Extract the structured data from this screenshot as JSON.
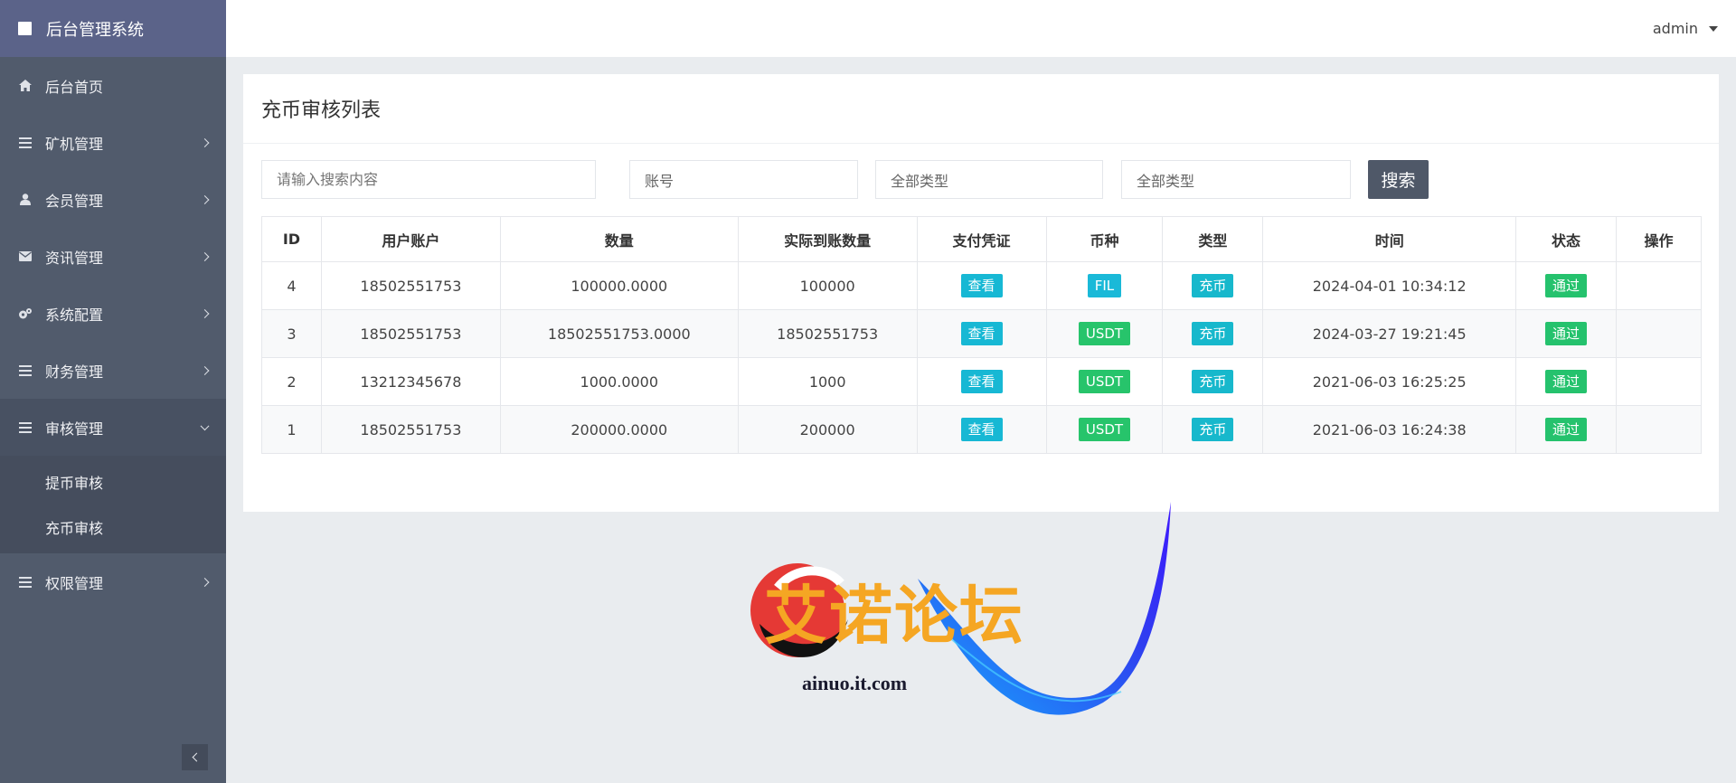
{
  "brand": {
    "title": "后台管理系统"
  },
  "header": {
    "user": "admin"
  },
  "sidebar": {
    "items": [
      {
        "label": "后台首页",
        "icon": "home-icon"
      },
      {
        "label": "矿机管理",
        "icon": "list-icon"
      },
      {
        "label": "会员管理",
        "icon": "user-icon"
      },
      {
        "label": "资讯管理",
        "icon": "mail-icon"
      },
      {
        "label": "系统配置",
        "icon": "gears-icon"
      },
      {
        "label": "财务管理",
        "icon": "list-icon"
      },
      {
        "label": "审核管理",
        "icon": "list-icon",
        "open": true
      },
      {
        "label": "权限管理",
        "icon": "list-icon"
      }
    ],
    "submenu": [
      {
        "label": "提币审核"
      },
      {
        "label": "充币审核"
      }
    ]
  },
  "main": {
    "title": "充币审核列表",
    "filters": {
      "search_placeholder": "请输入搜索内容",
      "account": "账号",
      "type1": "全部类型",
      "type2": "全部类型",
      "search_button": "搜索"
    },
    "table": {
      "headers": [
        "ID",
        "用户账户",
        "数量",
        "实际到账数量",
        "支付凭证",
        "币种",
        "类型",
        "时间",
        "状态",
        "操作"
      ],
      "rows": [
        {
          "id": "4",
          "account": "18502551753",
          "amount": "100000.0000",
          "actual": "100000",
          "proof": "查看",
          "coin": "FIL",
          "type": "充币",
          "time": "2024-04-01 10:34:12",
          "status": "通过"
        },
        {
          "id": "3",
          "account": "18502551753",
          "amount": "18502551753.0000",
          "actual": "18502551753",
          "proof": "查看",
          "coin": "USDT",
          "type": "充币",
          "time": "2024-03-27 19:21:45",
          "status": "通过"
        },
        {
          "id": "2",
          "account": "13212345678",
          "amount": "1000.0000",
          "actual": "1000",
          "proof": "查看",
          "coin": "USDT",
          "type": "充币",
          "time": "2021-06-03 16:25:25",
          "status": "通过"
        },
        {
          "id": "1",
          "account": "18502551753",
          "amount": "200000.0000",
          "actual": "200000",
          "proof": "查看",
          "coin": "USDT",
          "type": "充币",
          "time": "2021-06-03 16:24:38",
          "status": "通过"
        }
      ]
    }
  },
  "watermark": {
    "text": "艾诺论坛",
    "url": "ainuo.it.com"
  }
}
